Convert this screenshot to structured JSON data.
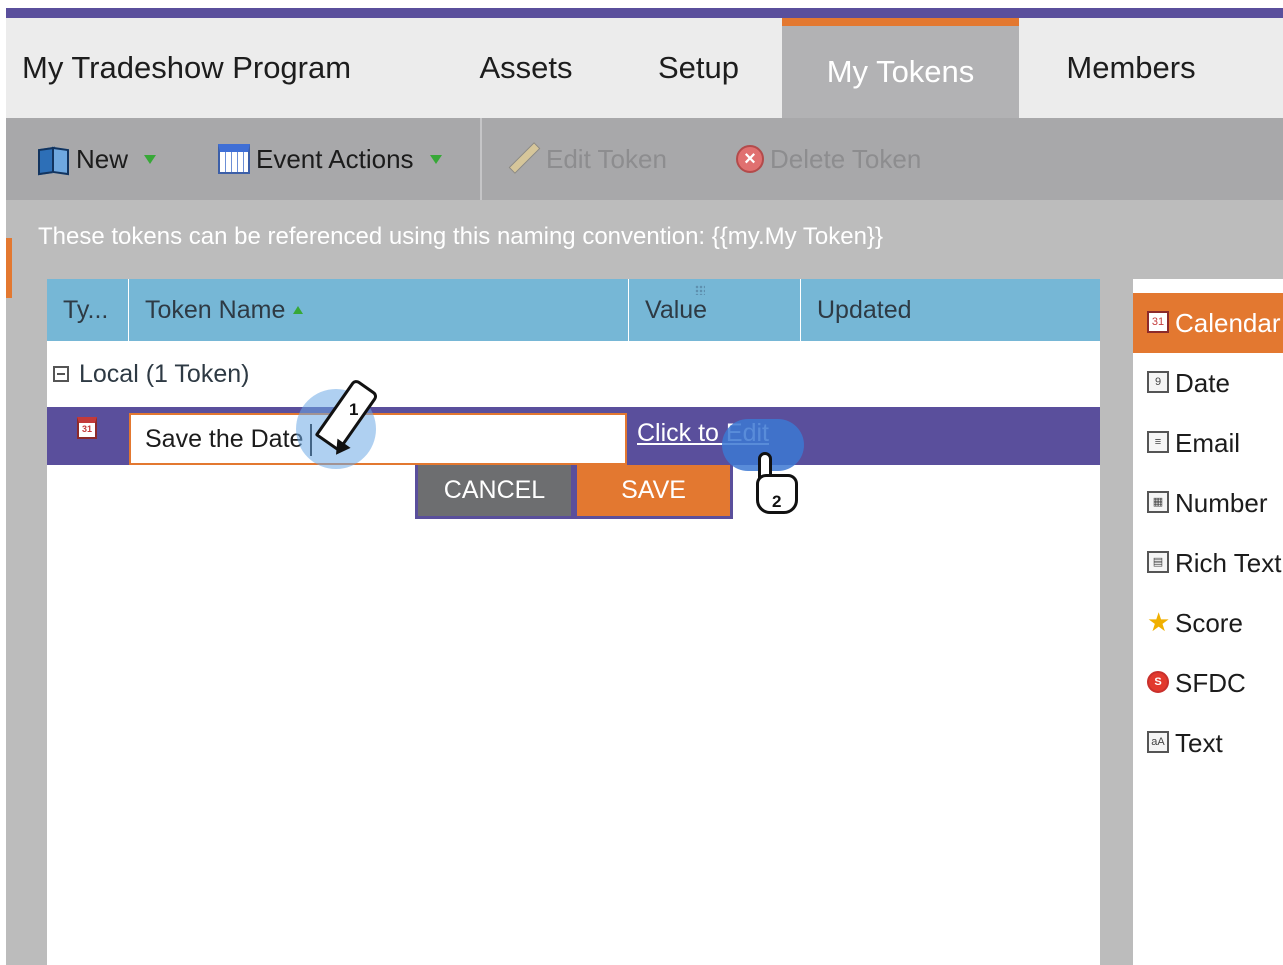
{
  "tabs": [
    {
      "label": "My Tradeshow Program"
    },
    {
      "label": "Assets"
    },
    {
      "label": "Setup"
    },
    {
      "label": "My Tokens",
      "active": true
    },
    {
      "label": "Members"
    }
  ],
  "toolbar": {
    "new_label": "New",
    "event_actions_label": "Event Actions",
    "edit_token_label": "Edit Token",
    "delete_token_label": "Delete Token"
  },
  "info_text": "These tokens can be referenced using this naming convention: {{my.My Token}}",
  "grid": {
    "columns": [
      "Ty...",
      "Token Name",
      "Value",
      "Updated"
    ],
    "group_label": "Local (1 Token)",
    "row": {
      "type_icon": "calendar-icon",
      "type_icon_text": "31",
      "name_value": "Save the Date",
      "value_link": "Click to Edit"
    },
    "cancel_label": "CANCEL",
    "save_label": "SAVE"
  },
  "token_types": [
    {
      "label": "Calendar",
      "icon": "calendar-icon",
      "icon_text": "31",
      "active": true
    },
    {
      "label": "Date",
      "icon": "date-icon",
      "icon_text": "9"
    },
    {
      "label": "Email",
      "icon": "email-script-icon",
      "icon_text": "≡"
    },
    {
      "label": "Number",
      "icon": "calculator-icon",
      "icon_text": "▦"
    },
    {
      "label": "Rich Text",
      "icon": "rich-text-icon",
      "icon_text": "▤"
    },
    {
      "label": "Score",
      "icon": "star-icon",
      "icon_text": "★"
    },
    {
      "label": "SFDC",
      "icon": "sfdc-icon",
      "icon_text": "S"
    },
    {
      "label": "Text",
      "icon": "text-icon",
      "icon_text": "aA"
    }
  ],
  "annotations": {
    "step1": "1",
    "step2": "2"
  },
  "colors": {
    "accent_orange": "#e37830",
    "selection_purple": "#5a4f9c",
    "header_blue": "#76b7d6"
  }
}
